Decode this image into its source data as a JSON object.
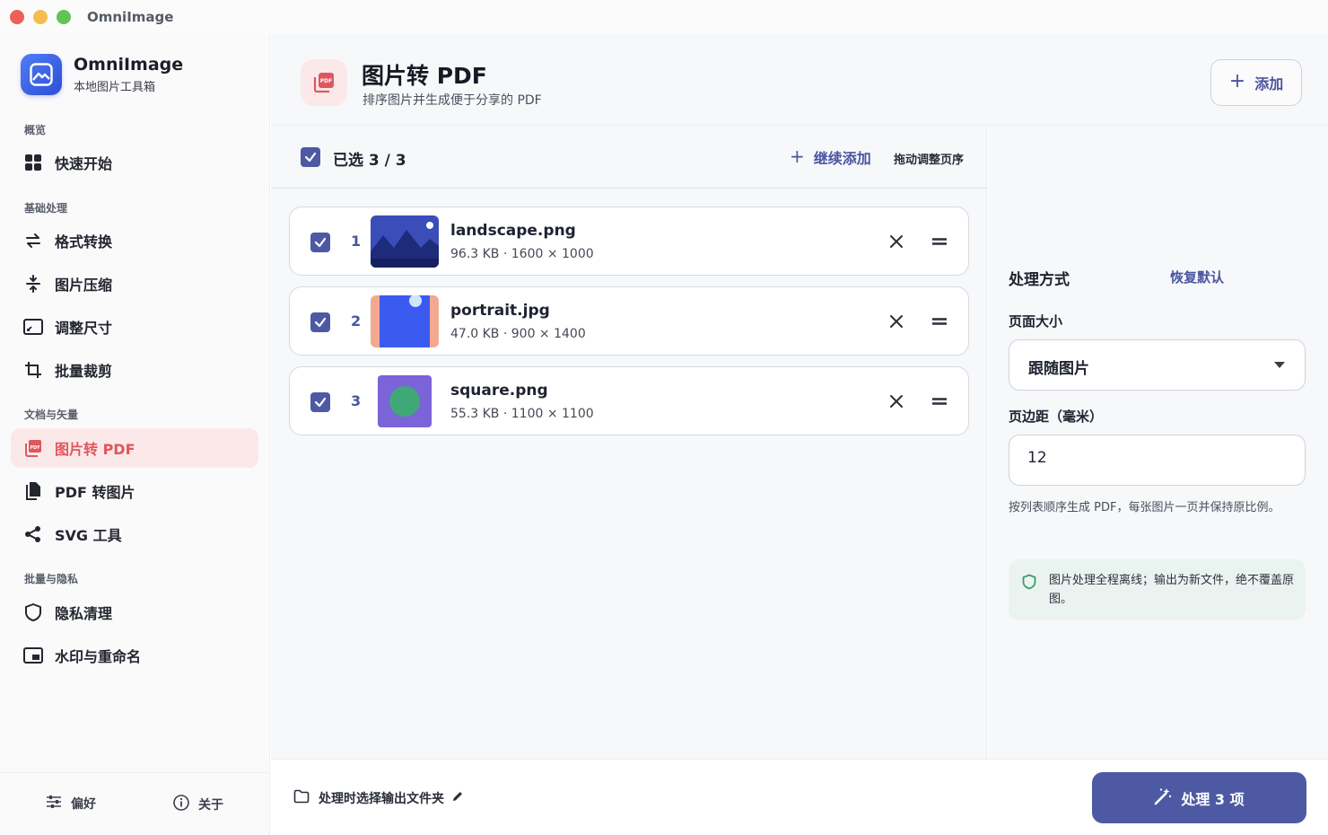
{
  "window": {
    "title": "OmniImage"
  },
  "brand": {
    "title": "OmniImage",
    "subtitle": "本地图片工具箱"
  },
  "sidebar": {
    "sections": [
      {
        "label": "概览",
        "items": [
          {
            "label": "快速开始",
            "icon": "grid-icon"
          }
        ]
      },
      {
        "label": "基础处理",
        "items": [
          {
            "label": "格式转换",
            "icon": "swap-arrows-icon"
          },
          {
            "label": "图片压缩",
            "icon": "compress-icon"
          },
          {
            "label": "调整尺寸",
            "icon": "resize-icon"
          },
          {
            "label": "批量裁剪",
            "icon": "crop-icon"
          }
        ]
      },
      {
        "label": "文档与矢量",
        "items": [
          {
            "label": "图片转 PDF",
            "icon": "pdf-icon",
            "active": true
          },
          {
            "label": "PDF 转图片",
            "icon": "copy-pages-icon"
          },
          {
            "label": "SVG 工具",
            "icon": "share-nodes-icon"
          }
        ]
      },
      {
        "label": "批量与隐私",
        "items": [
          {
            "label": "隐私清理",
            "icon": "shield-icon"
          },
          {
            "label": "水印与重命名",
            "icon": "watermark-icon"
          }
        ]
      }
    ],
    "footer": {
      "preferences": "偏好",
      "about": "关于"
    }
  },
  "header": {
    "title": "图片转 PDF",
    "subtitle": "排序图片并生成便于分享的 PDF",
    "add_button": "添加"
  },
  "list": {
    "selected_label": "已选 3 / 3",
    "continue_add": "继续添加",
    "drag_hint": "拖动调整页序",
    "files": [
      {
        "index": "1",
        "name": "landscape.png",
        "meta": "96.3 KB · 1600 × 1000",
        "checked": true
      },
      {
        "index": "2",
        "name": "portrait.jpg",
        "meta": "47.0 KB · 900 × 1400",
        "checked": true
      },
      {
        "index": "3",
        "name": "square.png",
        "meta": "55.3 KB · 1100 × 1100",
        "checked": true
      }
    ]
  },
  "settings": {
    "title": "处理方式",
    "reset": "恢复默认",
    "page_size_label": "页面大小",
    "page_size_value": "跟随图片",
    "margin_label": "页边距（毫米）",
    "margin_value": "12",
    "hint": "按列表顺序生成 PDF，每张图片一页并保持原比例。",
    "note": "图片处理全程离线；输出为新文件，绝不覆盖原图。"
  },
  "footer": {
    "output_folder": "处理时选择输出文件夹",
    "process_button": "处理 3 项"
  },
  "colors": {
    "accent": "#4d5aa3",
    "active_nav_bg": "#fbe9ea",
    "active_nav_text": "#e0565c",
    "note_bg": "#eaf3f0"
  }
}
